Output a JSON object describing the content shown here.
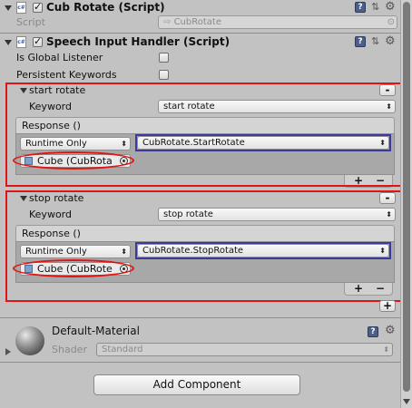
{
  "cub_rotate": {
    "title": "Cub Rotate (Script)",
    "script_label": "Script",
    "script_value": "CubRotate"
  },
  "speech": {
    "title": "Speech Input Handler (Script)",
    "is_global_label": "Is Global Listener",
    "persistent_label": "Persistent Keywords"
  },
  "keywords": [
    {
      "header": "start rotate",
      "keyword_label": "Keyword",
      "keyword_value": "start rotate",
      "response_label": "Response ()",
      "runtime": "Runtime Only",
      "function": "CubRotate.StartRotate",
      "object": "Cube (CubRota"
    },
    {
      "header": "stop rotate",
      "keyword_label": "Keyword",
      "keyword_value": "stop rotate",
      "response_label": "Response ()",
      "runtime": "Runtime Only",
      "function": "CubRotate.StopRotate",
      "object": "Cube (CubRote"
    }
  ],
  "buttons": {
    "minus": "-",
    "plus": "+",
    "remove": "−"
  },
  "material": {
    "name": "Default-Material",
    "shader_label": "Shader",
    "shader_value": "Standard"
  },
  "add_component": "Add Component",
  "colors": {
    "highlight_red": "#e01414",
    "selection_blue": "#3a3a9c",
    "panel": "#c2c2c2"
  }
}
